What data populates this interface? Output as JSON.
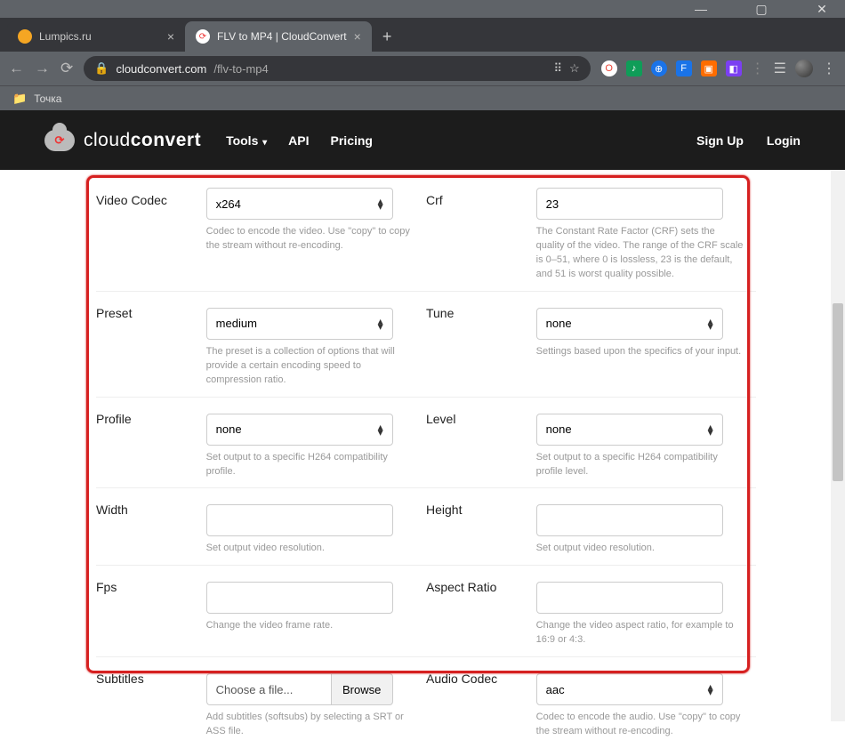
{
  "window": {
    "min": "—",
    "max": "▢",
    "close": "✕"
  },
  "tabs": [
    {
      "favicon_bg": "#f5a623",
      "title": "Lumpics.ru",
      "active": false
    },
    {
      "favicon_bg": "#ffffff",
      "title": "FLV to MP4 | CloudConvert",
      "active": true
    }
  ],
  "addr": {
    "lock": "🔒",
    "url_host": "cloudconvert.com",
    "url_path": "/flv-to-mp4"
  },
  "ext_colors": [
    "#ea4335",
    "#0f9d58",
    "#1a73e8",
    "#1a73e8",
    "#ff6d00",
    "#7b3ff2"
  ],
  "bookmark": {
    "folder": "Точка"
  },
  "header": {
    "brand_light": "cloud",
    "brand_bold": "convert",
    "menu": {
      "tools": "Tools",
      "api": "API",
      "pricing": "Pricing"
    },
    "auth": {
      "signup": "Sign Up",
      "login": "Login"
    }
  },
  "form": {
    "video_codec": {
      "label": "Video Codec",
      "value": "x264",
      "help": "Codec to encode the video. Use \"copy\" to copy the stream without re-encoding."
    },
    "crf": {
      "label": "Crf",
      "value": "23",
      "help": "The Constant Rate Factor (CRF) sets the quality of the video. The range of the CRF scale is 0–51, where 0 is lossless, 23 is the default, and 51 is worst quality possible."
    },
    "preset": {
      "label": "Preset",
      "value": "medium",
      "help": "The preset is a collection of options that will provide a certain encoding speed to compression ratio."
    },
    "tune": {
      "label": "Tune",
      "value": "none",
      "help": "Settings based upon the specifics of your input."
    },
    "profile": {
      "label": "Profile",
      "value": "none",
      "help": "Set output to a specific H264 compatibility profile."
    },
    "level": {
      "label": "Level",
      "value": "none",
      "help": "Set output to a specific H264 compatibility profile level."
    },
    "width": {
      "label": "Width",
      "value": "",
      "help": "Set output video resolution."
    },
    "height": {
      "label": "Height",
      "value": "",
      "help": "Set output video resolution."
    },
    "fps": {
      "label": "Fps",
      "value": "",
      "help": "Change the video frame rate."
    },
    "aspect": {
      "label": "Aspect Ratio",
      "value": "",
      "help": "Change the video aspect ratio, for example to 16:9 or 4:3."
    },
    "subtitles": {
      "label": "Subtitles",
      "placeholder": "Choose a file...",
      "browse": "Browse",
      "help": "Add subtitles (softsubs) by selecting a SRT or ASS file."
    },
    "audio_codec": {
      "label": "Audio Codec",
      "value": "aac",
      "help": "Codec to encode the audio. Use \"copy\" to copy the stream without re-encoding."
    }
  }
}
